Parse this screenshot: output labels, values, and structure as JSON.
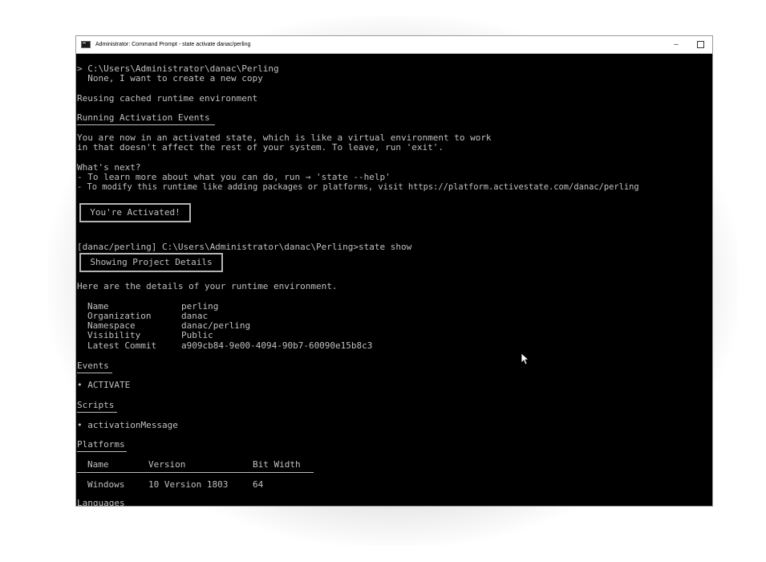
{
  "window": {
    "title": "Administrator: Command Prompt - state  activate danac/perling",
    "minimize": "–"
  },
  "console": {
    "l1": "> C:\\Users\\Administrator\\danac\\Perling",
    "l2": "  None, I want to create a new copy",
    "l3": "Reusing cached runtime environment",
    "l4": "Running Activation Events",
    "l5": "You are now in an activated state, which is like a virtual environment to work",
    "l6": "in that doesn't affect the rest of your system. To leave, run 'exit'.",
    "l7": "What's next?",
    "l8": "- To learn more about what you can do, run → 'state --help'",
    "l9": "- To modify this runtime like adding packages or platforms, visit https://platform.activestate.com/danac/perling",
    "activated": "You're Activated!",
    "prompt": "[danac/perling] C:\\Users\\Administrator\\danac\\Perling>state show",
    "show_details": "Showing Project Details",
    "intro": "Here are the details of your runtime environment.",
    "details": [
      {
        "label": "Name",
        "value": "perling"
      },
      {
        "label": "Organization",
        "value": "danac"
      },
      {
        "label": "Namespace",
        "value": "danac/perling"
      },
      {
        "label": "Visibility",
        "value": "Public"
      },
      {
        "label": "Latest Commit",
        "value": "a909cb84-9e00-4094-90b7-60090e15b8c3"
      }
    ],
    "events_heading": "Events",
    "events_item": "• ACTIVATE",
    "scripts_heading": "Scripts",
    "scripts_item": "• activationMessage",
    "platforms_heading": "Platforms",
    "platforms_table": {
      "headers": [
        "Name",
        "Version",
        "Bit Width"
      ],
      "rows": [
        [
          "Windows",
          "10 Version 1803",
          "64"
        ]
      ]
    },
    "languages_heading": "Languages"
  }
}
